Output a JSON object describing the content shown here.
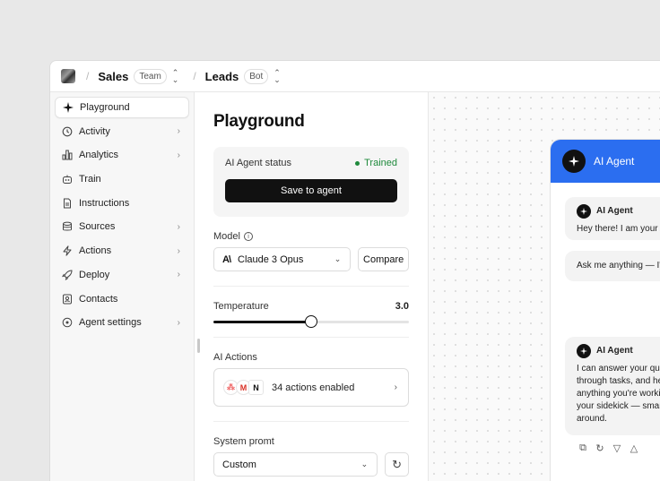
{
  "topbar": {
    "crumbs": [
      {
        "label": "Sales",
        "badge": "Team"
      },
      {
        "label": "Leads",
        "badge": "Bot"
      }
    ]
  },
  "sidebar": {
    "items": [
      {
        "label": "Playground",
        "icon": "sparkle-icon",
        "active": true,
        "chevron": false
      },
      {
        "label": "Activity",
        "icon": "history-icon",
        "chevron": true
      },
      {
        "label": "Analytics",
        "icon": "bar-chart-icon",
        "chevron": true
      },
      {
        "label": "Train",
        "icon": "robot-icon",
        "chevron": false
      },
      {
        "label": "Instructions",
        "icon": "document-icon",
        "chevron": false
      },
      {
        "label": "Sources",
        "icon": "database-icon",
        "chevron": true
      },
      {
        "label": "Actions",
        "icon": "lightning-icon",
        "chevron": true
      },
      {
        "label": "Deploy",
        "icon": "rocket-icon",
        "chevron": true
      },
      {
        "label": "Contacts",
        "icon": "contact-card-icon",
        "chevron": false
      },
      {
        "label": "Agent settings",
        "icon": "settings-icon",
        "chevron": true
      }
    ]
  },
  "panel": {
    "title": "Playground",
    "status": {
      "label": "AI Agent status",
      "value": "Trained",
      "value_color": "#1f8a3c"
    },
    "save_button": "Save to agent",
    "model": {
      "label": "Model",
      "selected": "Claude 3 Opus",
      "compare": "Compare"
    },
    "temperature": {
      "label": "Temperature",
      "value": "3.0",
      "fraction": 0.5
    },
    "actions": {
      "label": "AI Actions",
      "summary": "34 actions enabled",
      "apps": [
        "asana-icon",
        "gmail-icon",
        "notion-icon"
      ]
    },
    "prompt": {
      "label": "System promt",
      "selected": "Custom"
    }
  },
  "chat": {
    "header": "AI Agent",
    "accent": "#2b6ef0",
    "messages": [
      {
        "sender": "AI Agent",
        "lines": [
          "Hey there! I am your A"
        ]
      },
      {
        "sender": "",
        "lines": [
          "Ask me anything — I'm"
        ]
      },
      {
        "sender": "AI Agent",
        "lines": [
          "I can answer your que",
          "through tasks, and hel",
          "anything you're workin",
          "your sidekick — smart",
          "around."
        ]
      }
    ]
  }
}
